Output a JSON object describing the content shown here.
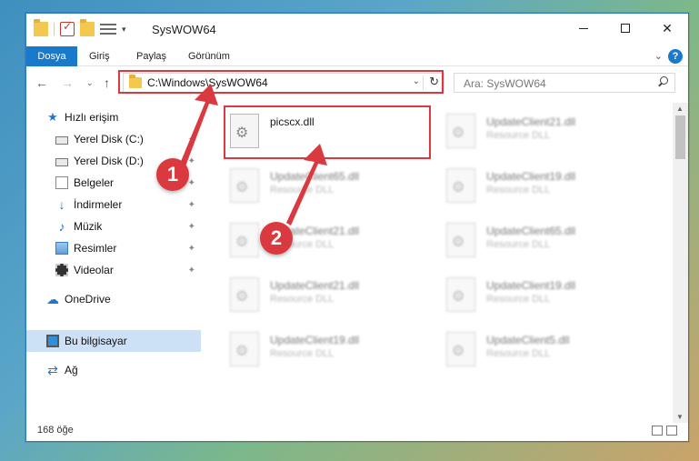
{
  "window": {
    "title": "SysWOW64",
    "minimize_glyph": "",
    "close_glyph": "✕"
  },
  "ribbon": {
    "tabs": [
      "Dosya",
      "Giriş",
      "Paylaş",
      "Görünüm"
    ],
    "help_glyph": "?",
    "collapse_glyph": "⌄"
  },
  "address_bar": {
    "path": "C:\\Windows\\SysWOW64",
    "search_placeholder": "Ara: SysWOW64"
  },
  "navigation": {
    "back_glyph": "←",
    "forward_glyph": "→",
    "recent_glyph": "⌄",
    "up_glyph": "↑",
    "refresh_glyph": "↻"
  },
  "sidebar": {
    "items": [
      {
        "label": "Hızlı erişim",
        "icon": "star-icon"
      },
      {
        "label": "Yerel Disk (C:)",
        "icon": "drive-icon",
        "pinned": true
      },
      {
        "label": "Yerel Disk (D:)",
        "icon": "drive-icon",
        "pinned": true
      },
      {
        "label": "Belgeler",
        "icon": "documents-icon",
        "pinned": true
      },
      {
        "label": "İndirmeler",
        "icon": "download-icon",
        "pinned": true
      },
      {
        "label": "Müzik",
        "icon": "music-icon",
        "pinned": true
      },
      {
        "label": "Resimler",
        "icon": "pictures-icon",
        "pinned": true
      },
      {
        "label": "Videolar",
        "icon": "videos-icon",
        "pinned": true
      },
      {
        "label": "OneDrive",
        "icon": "cloud-icon"
      },
      {
        "label": "Bu bilgisayar",
        "icon": "computer-icon",
        "selected": true
      },
      {
        "label": "Ağ",
        "icon": "network-icon"
      }
    ],
    "pin_glyph": "📌"
  },
  "files": [
    {
      "name": "picscx.dll",
      "description": ""
    },
    {
      "name": "UpdateClient21.dll",
      "description": "Resource DLL"
    },
    {
      "name": "UpdateClient65.dll",
      "description": "Resource DLL"
    },
    {
      "name": "UpdateClient19.dll",
      "description": "Resource DLL"
    },
    {
      "name": "UpdateClient21.dll",
      "description": "Resource DLL"
    },
    {
      "name": "UpdateClient65.dll",
      "description": "Resource DLL"
    },
    {
      "name": "UpdateClient21.dll",
      "description": "Resource DLL"
    },
    {
      "name": "UpdateClient19.dll",
      "description": "Resource DLL"
    },
    {
      "name": "UpdateClient19.dll",
      "description": "Resource DLL"
    },
    {
      "name": "UpdateClient5.dll",
      "description": "Resource DLL"
    }
  ],
  "status_bar": {
    "item_count": "168 öğe"
  },
  "annotations": {
    "step1": "1",
    "step2": "2",
    "highlight_color": "#d9393f"
  },
  "scrollbar": {
    "up_glyph": "▲",
    "down_glyph": "▼"
  }
}
